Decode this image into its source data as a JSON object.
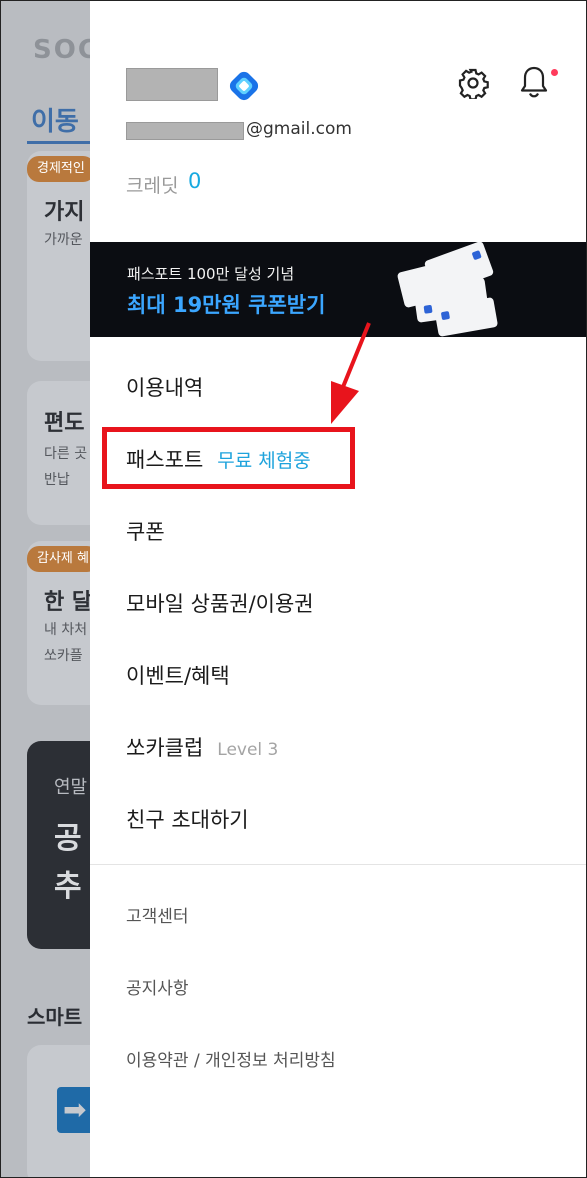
{
  "background": {
    "logo": "SOC",
    "tab": "이동",
    "cards": [
      {
        "badge": "경제적인",
        "title": "가지",
        "sub": "가까운"
      },
      {
        "badge": "",
        "title": "편도",
        "sub": "다른 곳",
        "sub2": "반납"
      },
      {
        "badge": "감사제 혜",
        "title": "한 달",
        "sub": "내 차처",
        "sub2": "쏘카플"
      }
    ],
    "promo": {
      "small": "연말",
      "line1": "공",
      "line2": "추"
    },
    "section_title": "스마트"
  },
  "profile": {
    "email_suffix": "@gmail.com",
    "credit_label": "크레딧",
    "credit_value": "0"
  },
  "banner": {
    "subtitle": "패스포트 100만 달성 기념",
    "title": "최대 19만원 쿠폰받기"
  },
  "menu": [
    {
      "label": "이용내역"
    },
    {
      "label": "패스포트",
      "trial": "무료 체험중"
    },
    {
      "label": "쿠폰"
    },
    {
      "label": "모바일 상품권/이용권"
    },
    {
      "label": "이벤트/혜택"
    },
    {
      "label": "쏘카클럽",
      "extra": "Level 3"
    },
    {
      "label": "친구 초대하기"
    }
  ],
  "sub_menu": [
    {
      "label": "고객센터"
    },
    {
      "label": "공지사항"
    },
    {
      "label": "이용약관 / 개인정보 처리방침"
    }
  ],
  "colors": {
    "accent": "#1ea3dc",
    "banner_title": "#3ba6ff",
    "highlight": "#e8141c",
    "notification_dot": "#ff3b5c"
  }
}
